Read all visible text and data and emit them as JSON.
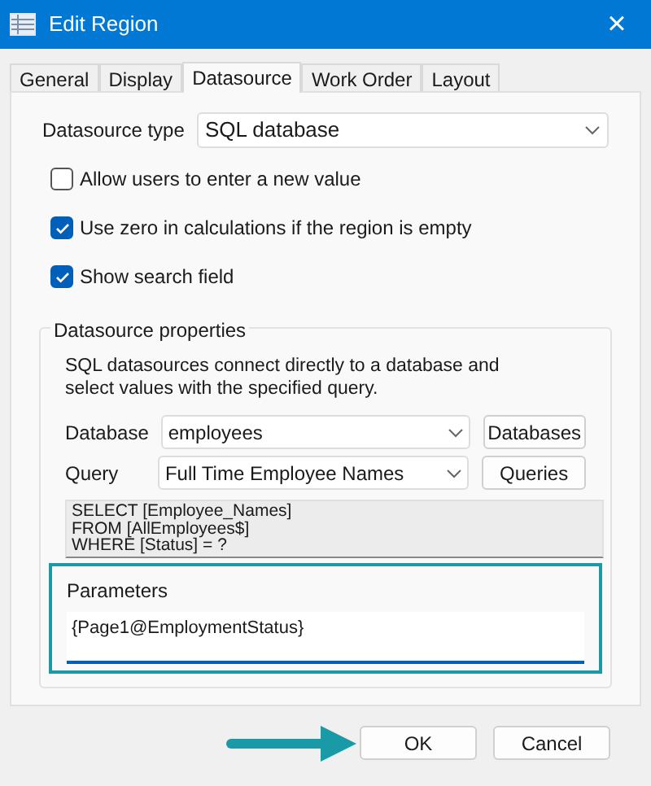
{
  "window": {
    "title": "Edit Region",
    "close": "×"
  },
  "tabs": [
    {
      "label": "General",
      "selected": false
    },
    {
      "label": "Display",
      "selected": false
    },
    {
      "label": "Datasource",
      "selected": true
    },
    {
      "label": "Work Order",
      "selected": false
    },
    {
      "label": "Layout",
      "selected": false
    }
  ],
  "datasource_type": {
    "label": "Datasource type",
    "value": "SQL database"
  },
  "checkboxes": [
    {
      "label": "Allow users to enter a new value",
      "checked": false
    },
    {
      "label": "Use zero in calculations if the region is empty",
      "checked": true
    },
    {
      "label": "Show search field",
      "checked": true
    }
  ],
  "properties": {
    "title": "Datasource properties",
    "description": "SQL datasources connect directly to a database and select values with the specified query.",
    "fields": [
      {
        "label": "Database",
        "value": "employees",
        "button": "Databases"
      },
      {
        "label": "Query",
        "value": "Full Time Employee Names",
        "button": "Queries"
      }
    ],
    "sql_lines": [
      "SELECT [Employee_Names]",
      "FROM [AllEmployees$]",
      "WHERE [Status] = ?"
    ],
    "parameters": {
      "label": "Parameters",
      "value": "{Page1@EmploymentStatus}"
    }
  },
  "buttons": [
    {
      "label": "OK",
      "highlighted": true
    },
    {
      "label": "Cancel",
      "highlighted": false
    }
  ]
}
